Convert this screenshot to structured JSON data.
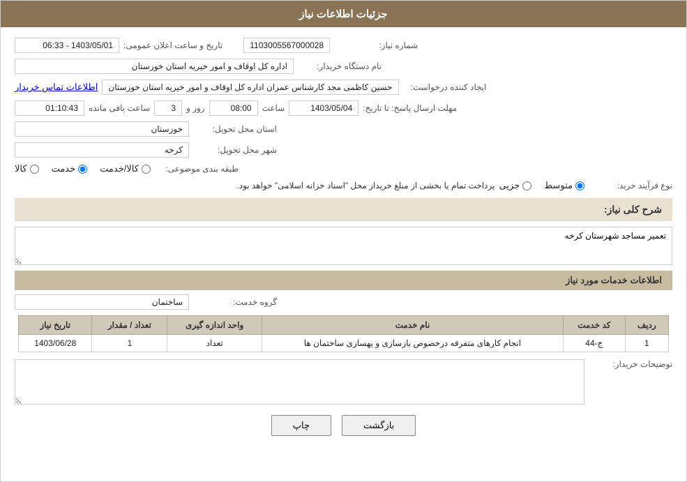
{
  "header": {
    "title": "جزئیات اطلاعات نیاز"
  },
  "fields": {
    "request_number_label": "شماره نیاز:",
    "request_number_value": "1103005567000028",
    "buyer_org_label": "نام دستگاه خریدار:",
    "buyer_org_value": "اداره کل اوقاف و امور خیریه استان خوزستان",
    "creator_label": "ایجاد کننده درخواست:",
    "creator_value": "حسین کاظمی مجد کارشناس عمران اداره کل اوقاف و امور خیریه استان خوزستان",
    "contact_link": "اطلاعات تماس خریدار",
    "deadline_label": "مهلت ارسال پاسخ: تا تاریخ:",
    "deadline_date": "1403/05/04",
    "deadline_time_label": "ساعت",
    "deadline_time_value": "08:00",
    "deadline_days_label": "روز و",
    "deadline_days_value": "3",
    "deadline_remaining_label": "ساعت باقی مانده",
    "deadline_remaining_value": "01:10:43",
    "province_label": "استان محل تحویل:",
    "province_value": "خوزستان",
    "city_label": "شهر محل تحویل:",
    "city_value": "کرخه",
    "announce_label": "تاریخ و ساعت اعلان عمومی:",
    "announce_value": "1403/05/01 - 06:33",
    "category_label": "طبقه بندی موضوعی:",
    "category_options": [
      "کالا",
      "خدمت",
      "کالا/خدمت"
    ],
    "category_selected": "خدمت",
    "purchase_type_label": "نوع فرآیند خرید:",
    "purchase_type_options": [
      "جزیی",
      "متوسط"
    ],
    "purchase_type_selected": "متوسط",
    "purchase_type_note": "پرداخت تمام یا بخشی از مبلغ خریداز محل \"اسناد خزانه اسلامی\" خواهد بود.",
    "description_section_title": "شرح کلی نیاز:",
    "description_value": "تعمیر مساجد شهرستان کرخه",
    "services_section_title": "اطلاعات خدمات مورد نیاز",
    "service_group_label": "گروه خدمت:",
    "service_group_value": "ساختمان",
    "table": {
      "columns": [
        "ردیف",
        "کد خدمت",
        "نام خدمت",
        "واحد اندازه گیری",
        "تعداد / مقدار",
        "تاریخ نیاز"
      ],
      "rows": [
        {
          "row": "1",
          "code": "ج-44",
          "name": "انجام کارهای متفرقه درخصوص بازسازی و بهسازی ساختمان ها",
          "unit": "تعداد",
          "quantity": "1",
          "date": "1403/06/28"
        }
      ]
    },
    "buyer_notes_label": "توضیحات خریدار:",
    "buyer_notes_value": "",
    "btn_print": "چاپ",
    "btn_back": "بازگشت"
  }
}
